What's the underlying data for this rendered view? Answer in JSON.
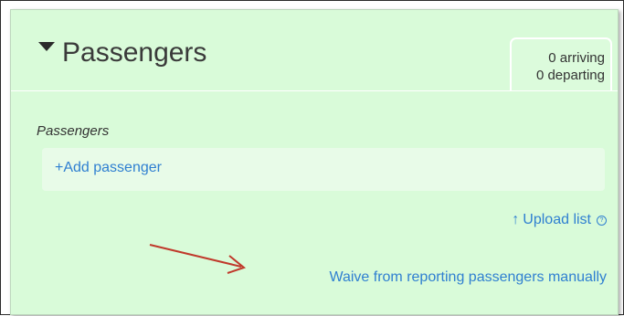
{
  "panel": {
    "title": "Passengers",
    "counts": {
      "arriving": "0 arriving",
      "departing": "0 departing"
    },
    "section_label": "Passengers",
    "add_passenger": "+Add passenger",
    "upload_list": "Upload list",
    "waive_link": "Waive from reporting passengers manually"
  },
  "icons": {
    "toggle": "caret-down-icon",
    "upload": "arrow-up-icon",
    "help": "question-circle-icon"
  },
  "colors": {
    "panel_bg": "#d9fbd9",
    "link": "#2f7fd1",
    "annotation_arrow": "#c0392b"
  }
}
